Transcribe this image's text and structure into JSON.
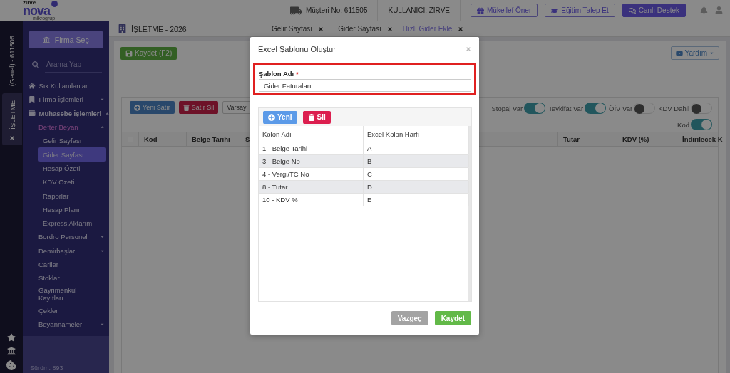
{
  "header": {
    "logo": {
      "top": "zirve",
      "name": "nova",
      "tagline": "mikrogrup"
    },
    "customer": "Müşteri No: 611505",
    "user": "KULLANICI: ZIRVE",
    "buttons": [
      {
        "label": "Mükellef Öner",
        "kind": "outline"
      },
      {
        "label": "Eğitim Talep Et",
        "kind": "outline"
      },
      {
        "label": "Canlı Destek",
        "kind": "primary"
      }
    ]
  },
  "left_strip": {
    "account": "(Genel) - 611505",
    "tabs": [
      {
        "label": "İŞLETME",
        "selected": true
      }
    ]
  },
  "sidebar": {
    "firm_button": "Firma Seç",
    "search": {
      "placeholder": "Arama Yap"
    },
    "version": "Sürüm: 893",
    "items": [
      {
        "label": "Sık Kullanılanlar",
        "kind": "link",
        "selected": false
      },
      {
        "label": "Firma İşlemleri",
        "kind": "group",
        "expanded": false
      },
      {
        "label": "Muhasebe İşlemleri",
        "kind": "group",
        "expanded": true,
        "children": [
          {
            "label": "Defter Beyan",
            "kind": "group",
            "expanded": true,
            "children": [
              {
                "label": "Gelir Sayfası",
                "kind": "link",
                "selected": false
              },
              {
                "label": "Gider Sayfası",
                "kind": "link",
                "selected": true
              },
              {
                "label": "Hesap Özeti",
                "kind": "link",
                "selected": false
              },
              {
                "label": "KDV Özeti",
                "kind": "link",
                "selected": false
              },
              {
                "label": "Raporlar",
                "kind": "link",
                "selected": false
              },
              {
                "label": "Hesap Planı",
                "kind": "link",
                "selected": false
              },
              {
                "label": "Express Aktarım",
                "kind": "link",
                "selected": false
              }
            ]
          },
          {
            "label": "Bordro Personel",
            "kind": "group",
            "expanded": false
          },
          {
            "label": "Demirbaşlar",
            "kind": "group",
            "expanded": false
          },
          {
            "label": "Cariler",
            "kind": "link",
            "selected": false
          },
          {
            "label": "Stoklar",
            "kind": "link",
            "selected": false
          },
          {
            "label": "Gayrimenkul Kayıtları",
            "kind": "link",
            "selected": false
          },
          {
            "label": "Çekler",
            "kind": "link",
            "selected": false
          },
          {
            "label": "Beyannameler",
            "kind": "group",
            "expanded": false
          }
        ]
      }
    ]
  },
  "workspace": {
    "title": "İŞLETME - 2026",
    "tabs": [
      {
        "label": "Gelir Sayfası",
        "selected": false
      },
      {
        "label": "Gider Sayfası",
        "selected": false
      },
      {
        "label": "Hızlı Gider Ekle",
        "selected": true
      }
    ]
  },
  "toolbar": {
    "save": "Kaydet (F2)",
    "help": "Yardım"
  },
  "grid": {
    "buttons": [
      {
        "label": "Yeni Satır",
        "kind": "add"
      },
      {
        "label": "Satır Sil",
        "kind": "delete"
      },
      {
        "label": "Varsay",
        "kind": "default"
      }
    ],
    "switches": [
      {
        "label": "Stopaj Var",
        "on": true
      },
      {
        "label": "Tevkifat Var",
        "on": true
      },
      {
        "label": "ÖİV Var",
        "on": false
      },
      {
        "label": "KDV Dahil",
        "on": false
      },
      {
        "label": "Kod",
        "on": true
      }
    ],
    "select_all": {
      "checked": false
    },
    "columns": [
      "Kod",
      "Belge Tarihi",
      "S",
      "Tutar",
      "KDV (%)",
      "İndirilecek K"
    ]
  },
  "dialog": {
    "title": "Excel Şablonu Oluştur",
    "name_field": {
      "label": "Şablon Adı",
      "required_mark": "*",
      "value": "Gider Faturaları",
      "highlighted": true
    },
    "buttons": [
      {
        "label": "Yeni",
        "kind": "add"
      },
      {
        "label": "Sil",
        "kind": "delete"
      }
    ],
    "columns": [
      "Kolon Adı",
      "Excel Kolon Harfi"
    ],
    "rows": [
      [
        "1 - Belge Tarihi",
        "A"
      ],
      [
        "3 - Belge No",
        "B"
      ],
      [
        "4 - Vergi/TC No",
        "C"
      ],
      [
        "8 - Tutar",
        "D"
      ],
      [
        "10 - KDV %",
        "E"
      ]
    ],
    "actions": [
      {
        "label": "Vazgeç",
        "kind": "cancel"
      },
      {
        "label": "Kaydet",
        "kind": "save"
      }
    ]
  }
}
